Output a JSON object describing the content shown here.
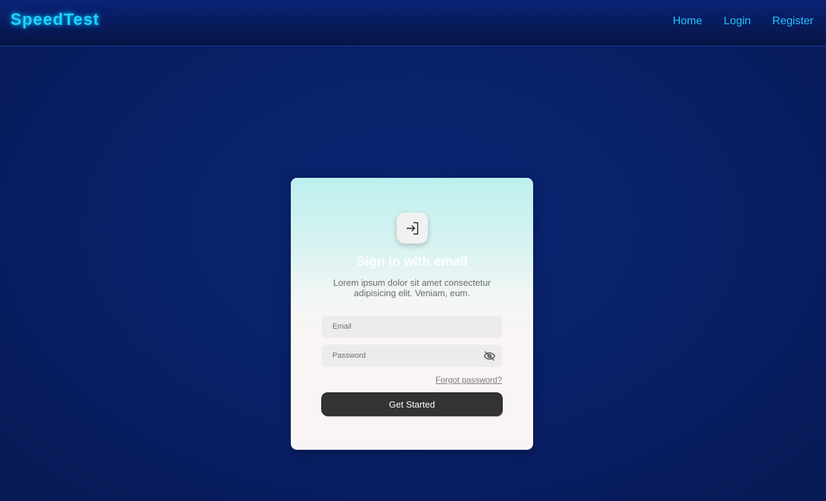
{
  "nav": {
    "brand": "SpeedTest",
    "links": [
      "Home",
      "Login",
      "Register"
    ]
  },
  "card": {
    "icon": "sign-in-icon",
    "title": "Sign in with email",
    "description": "Lorem ipsum dolor sit amet consectetur adipisicing elit. Veniam, eum.",
    "email_placeholder": "Email",
    "password_placeholder": "Password",
    "password_toggle_icon": "eye-off-icon",
    "forgot_label": "Forgot password?",
    "submit_label": "Get Started"
  },
  "colors": {
    "accent": "#22c7ff",
    "background": "#09216a",
    "button": "#333333"
  }
}
